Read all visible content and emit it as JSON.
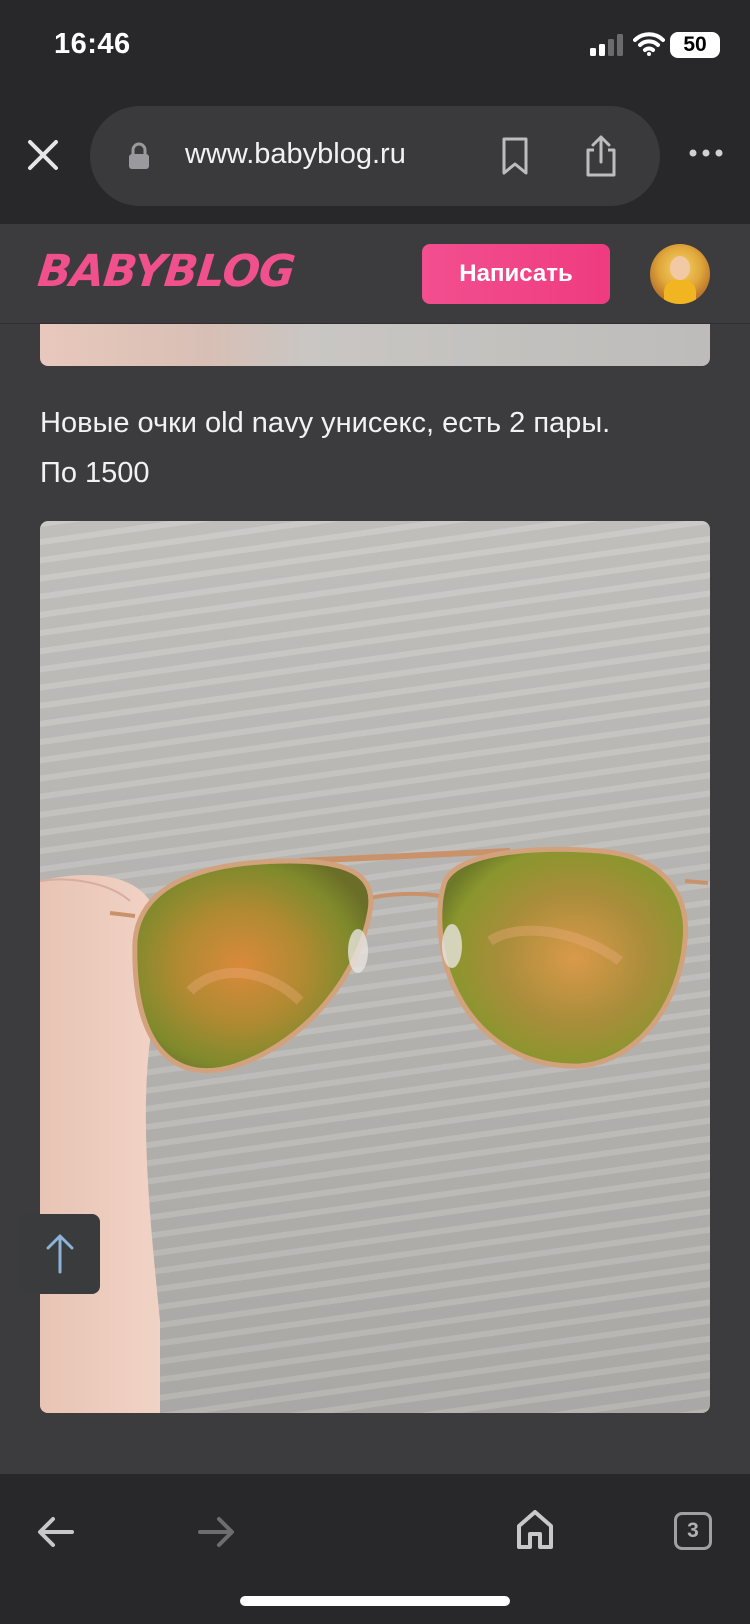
{
  "status_bar": {
    "time": "16:46",
    "battery": "50",
    "icons": [
      "cellular-signal-icon",
      "wifi-icon",
      "battery-icon"
    ]
  },
  "browser": {
    "url": "www.babyblog.ru",
    "icons": [
      "close-icon",
      "lock-icon",
      "bookmark-icon",
      "share-icon",
      "more-icon"
    ]
  },
  "site_header": {
    "logo": "BABYBLOG",
    "write_button": "Написать",
    "brand_color": "#f0508c"
  },
  "post": {
    "text_line1": "Новые очки old navy унисекс, есть 2 пары.",
    "text_line2": "По 1500"
  },
  "bottom_toolbar": {
    "tabs_count": "3",
    "icons": [
      "back-arrow-icon",
      "forward-arrow-icon",
      "home-icon",
      "tabs-icon"
    ]
  }
}
